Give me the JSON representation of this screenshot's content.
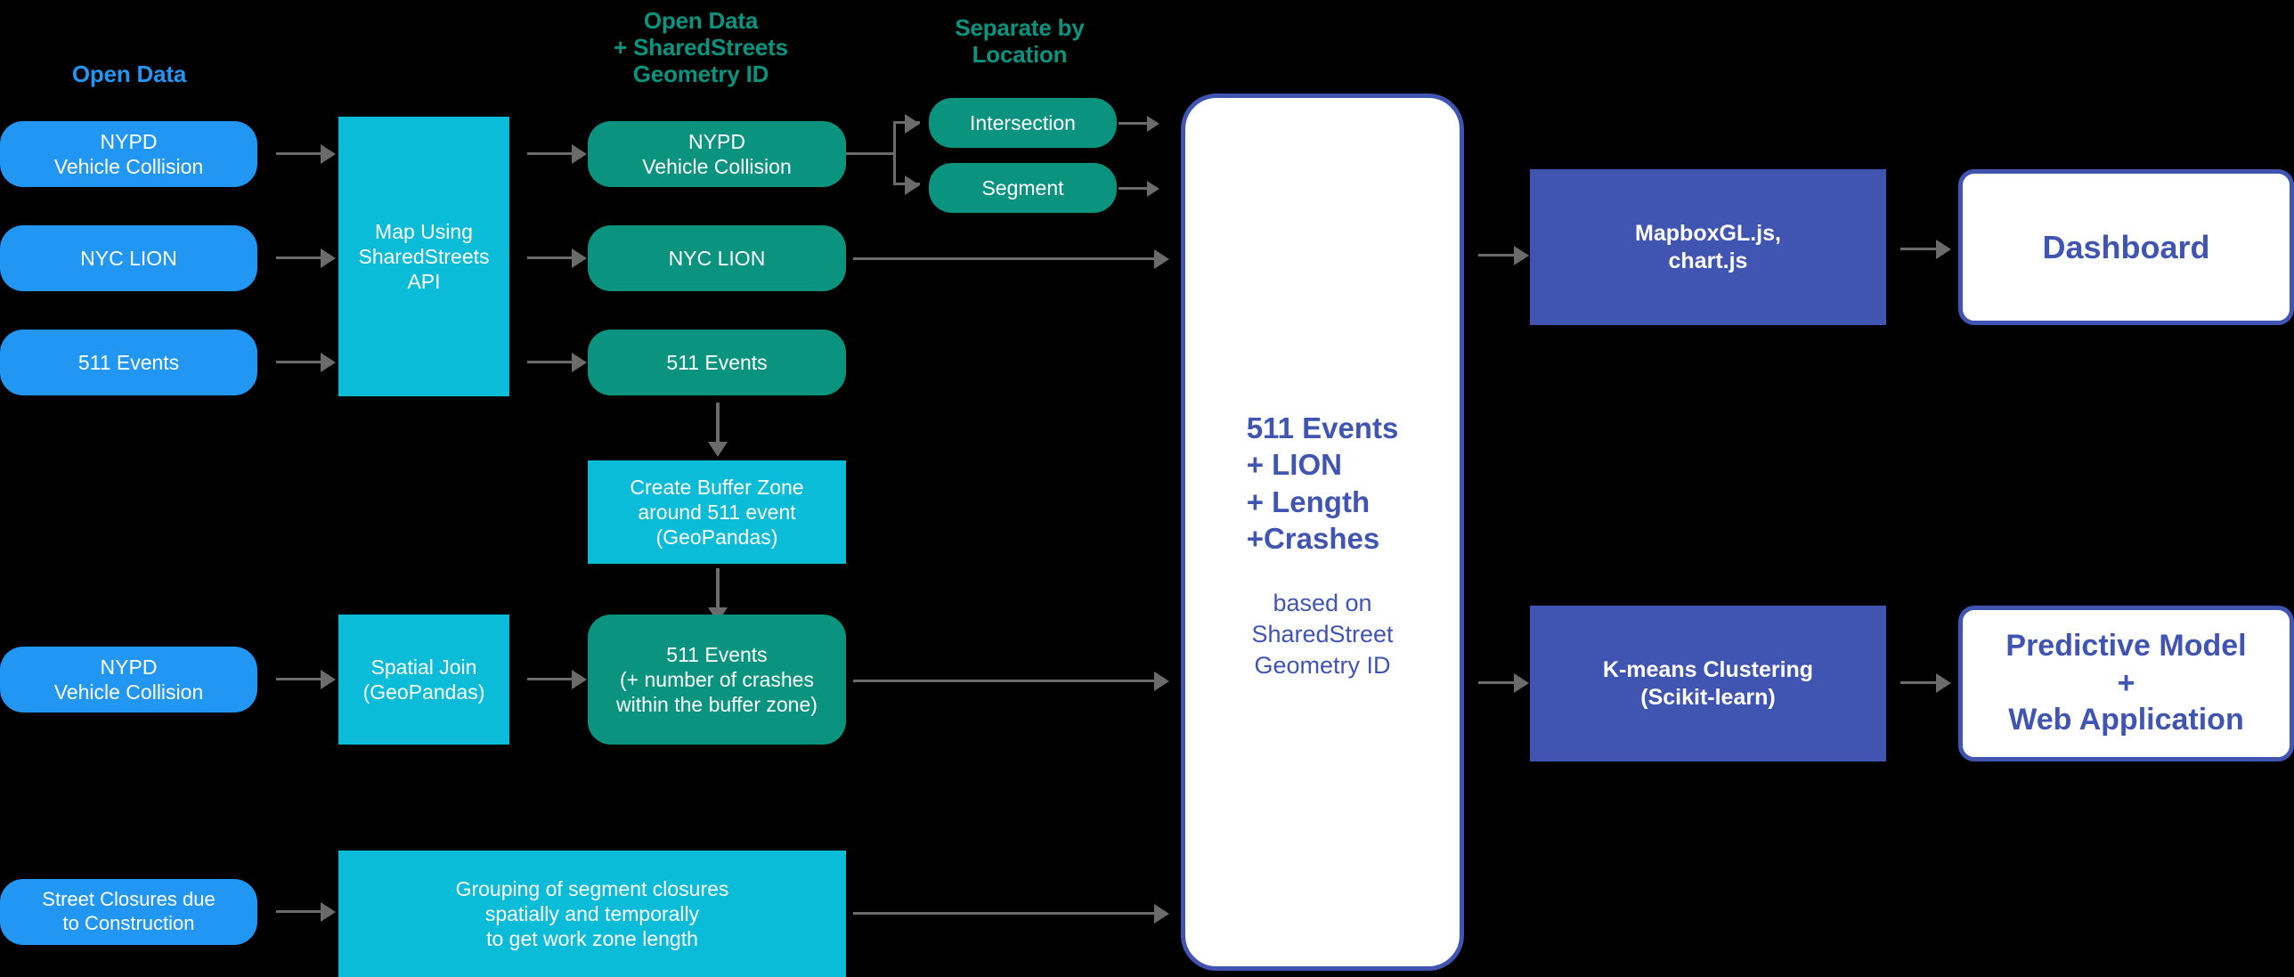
{
  "headings": [
    {
      "id": "open-data",
      "text": "Open Data",
      "color": "#2196f3"
    },
    {
      "id": "open-data-ss",
      "text": "Open Data\n+ SharedStreets\nGeometry ID",
      "color": "#0a9480"
    },
    {
      "id": "separate-by-loc",
      "text": "Separate by\nLocation",
      "color": "#0a9480"
    }
  ],
  "sources": [
    {
      "id": "nypd-vehicle-collision-1",
      "label": "NYPD\nVehicle Collision"
    },
    {
      "id": "nyc-lion",
      "label": "NYC LION"
    },
    {
      "id": "511-events",
      "label": "511 Events"
    },
    {
      "id": "nypd-vehicle-collision-2",
      "label": "NYPD\nVehicle Collision"
    },
    {
      "id": "street-closures",
      "label": "Street Closures due\nto Construction"
    }
  ],
  "processes": [
    {
      "id": "map-using-sharedstreets",
      "label": "Map Using\nSharedStreets\nAPI"
    },
    {
      "id": "create-buffer-zone",
      "label": "Create Buffer Zone\naround 511 event\n(GeoPandas)"
    },
    {
      "id": "spatial-join",
      "label": "Spatial Join\n(GeoPandas)"
    },
    {
      "id": "grouping-segment-closures",
      "label": "Grouping of segment closures\nspatially and temporally\nto get work zone length"
    }
  ],
  "mapped": [
    {
      "id": "mapped-nypd-vehicle-collision",
      "label": "NYPD\nVehicle Collision"
    },
    {
      "id": "mapped-nyc-lion",
      "label": "NYC LION"
    },
    {
      "id": "mapped-511-events",
      "label": "511 Events"
    },
    {
      "id": "511-events-with-crashes",
      "label": "511 Events\n(+ number of crashes\nwithin the buffer zone)"
    }
  ],
  "location_split": [
    {
      "id": "intersection",
      "label": "Intersection"
    },
    {
      "id": "segment",
      "label": "Segment"
    }
  ],
  "aggregate": {
    "id": "combined-dataset",
    "title": "511 Events\n+ LION\n+ Length\n+Crashes",
    "subtitle": "based on\nSharedStreet\nGeometry ID"
  },
  "tools": [
    {
      "id": "mapbox-chart",
      "label": "MapboxGL.js,\nchart.js"
    },
    {
      "id": "kmeans",
      "label": "K-means Clustering\n(Scikit-learn)"
    }
  ],
  "outputs": [
    {
      "id": "dashboard",
      "label": "Dashboard"
    },
    {
      "id": "predictive-model-app",
      "label": "Predictive Model\n+\nWeb Application"
    }
  ],
  "colors": {
    "background": "#000000",
    "source_blue": "#2196f3",
    "process_cyan": "#0bbcd8",
    "mapped_teal": "#0a9480",
    "tool_indigo": "#4054b2",
    "output_white": "#ffffff",
    "connector_gray": "#6b6b6b"
  }
}
